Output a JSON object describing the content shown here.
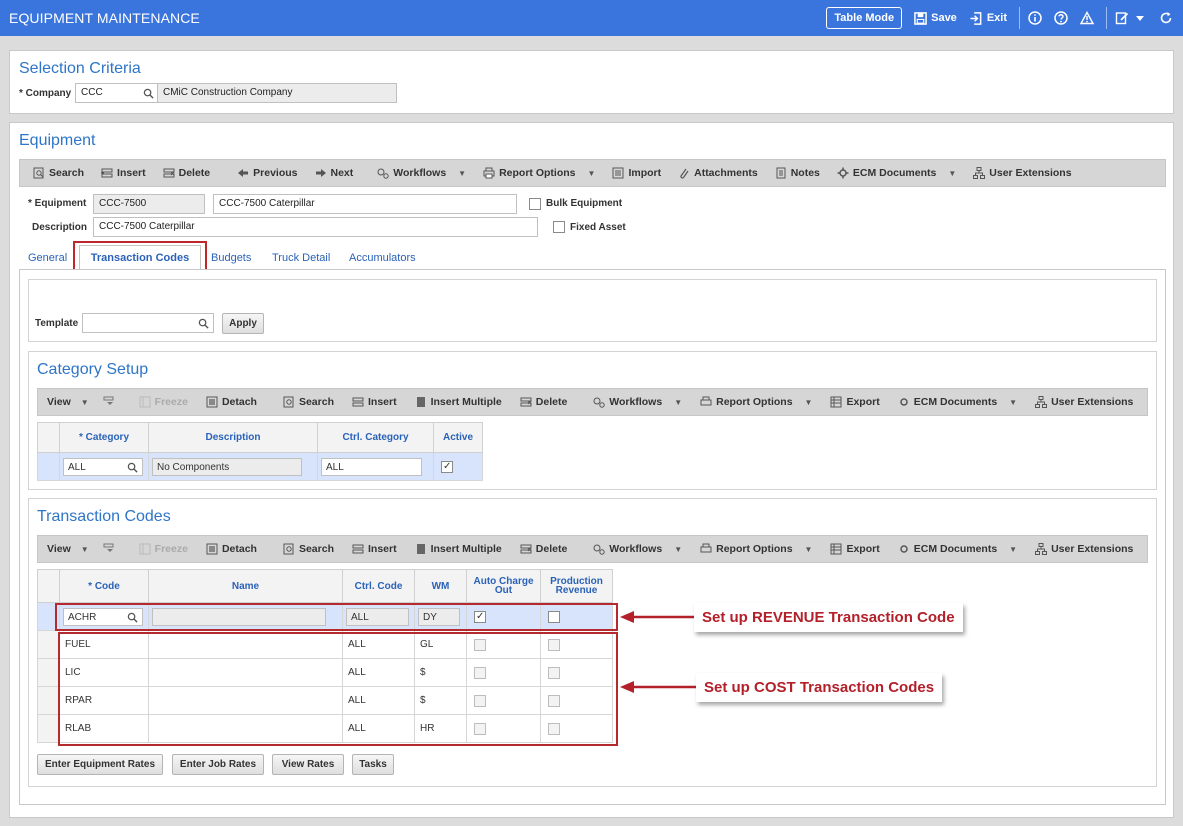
{
  "app": {
    "title": "EQUIPMENT MAINTENANCE",
    "table_mode": "Table Mode",
    "save": "Save",
    "exit": "Exit"
  },
  "selection": {
    "title": "Selection Criteria",
    "company_label": "* Company",
    "company_code": "CCC",
    "company_name": "CMiC Construction Company"
  },
  "equipment": {
    "title": "Equipment",
    "toolbar": {
      "search": "Search",
      "insert": "Insert",
      "delete": "Delete",
      "previous": "Previous",
      "next": "Next",
      "workflows": "Workflows",
      "report_options": "Report Options",
      "import": "Import",
      "attachments": "Attachments",
      "notes": "Notes",
      "ecm_documents": "ECM Documents",
      "user_extensions": "User Extensions"
    },
    "equipment_label": "* Equipment",
    "equipment_code": "CCC-7500",
    "equipment_name": "CCC-7500 Caterpillar",
    "description_label": "Description",
    "description_value": "CCC-7500 Caterpillar",
    "bulk_label": "Bulk Equipment",
    "fixed_label": "Fixed Asset",
    "tabs": [
      "General",
      "Transaction Codes",
      "Budgets",
      "Truck Detail",
      "Accumulators"
    ]
  },
  "template": {
    "label": "Template",
    "value": "",
    "apply": "Apply"
  },
  "grid_toolbar": {
    "view": "View",
    "freeze": "Freeze",
    "detach": "Detach",
    "search": "Search",
    "insert": "Insert",
    "insert_multiple": "Insert Multiple",
    "delete": "Delete",
    "workflows": "Workflows",
    "report_options": "Report Options",
    "export": "Export",
    "ecm_documents": "ECM Documents",
    "user_extensions": "User Extensions"
  },
  "category": {
    "title": "Category Setup",
    "headers": [
      "* Category",
      "Description",
      "Ctrl. Category",
      "Active"
    ],
    "row": {
      "category": "ALL",
      "description": "No Components",
      "ctrl": "ALL",
      "active": true
    }
  },
  "transactions": {
    "title": "Transaction Codes",
    "headers": {
      "code": "* Code",
      "name": "Name",
      "ctrl": "Ctrl. Code",
      "wm": "WM",
      "auto_1": "Auto Charge",
      "auto_2": "Out",
      "prod_1": "Production",
      "prod_2": "Revenue"
    },
    "rows": [
      {
        "code": "ACHR",
        "name": "",
        "ctrl": "ALL",
        "wm": "DY",
        "auto": true,
        "prod": false
      },
      {
        "code": "FUEL",
        "name": "",
        "ctrl": "ALL",
        "wm": "GL",
        "auto": false,
        "prod": false
      },
      {
        "code": "LIC",
        "name": "",
        "ctrl": "ALL",
        "wm": "$",
        "auto": false,
        "prod": false
      },
      {
        "code": "RPAR",
        "name": "",
        "ctrl": "ALL",
        "wm": "$",
        "auto": false,
        "prod": false
      },
      {
        "code": "RLAB",
        "name": "",
        "ctrl": "ALL",
        "wm": "HR",
        "auto": false,
        "prod": false
      }
    ],
    "buttons": [
      "Enter Equipment Rates",
      "Enter Job Rates",
      "View Rates",
      "Tasks"
    ]
  },
  "callouts": {
    "revenue": "Set up REVENUE Transaction Code",
    "cost": "Set up COST Transaction Codes"
  }
}
